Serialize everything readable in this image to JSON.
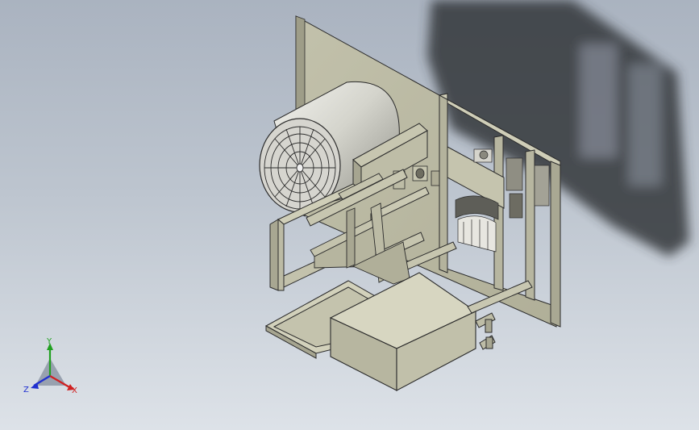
{
  "view": {
    "background_top": "#aab3c0",
    "background_bottom": "#dde2e8"
  },
  "triad": {
    "x_label": "X",
    "y_label": "Y",
    "z_label": "Z",
    "x_color": "#d02020",
    "y_color": "#20a020",
    "z_color": "#2030d0"
  },
  "model": {
    "part_color": "#c9c8b2",
    "edge_color": "#2b2b2b"
  }
}
